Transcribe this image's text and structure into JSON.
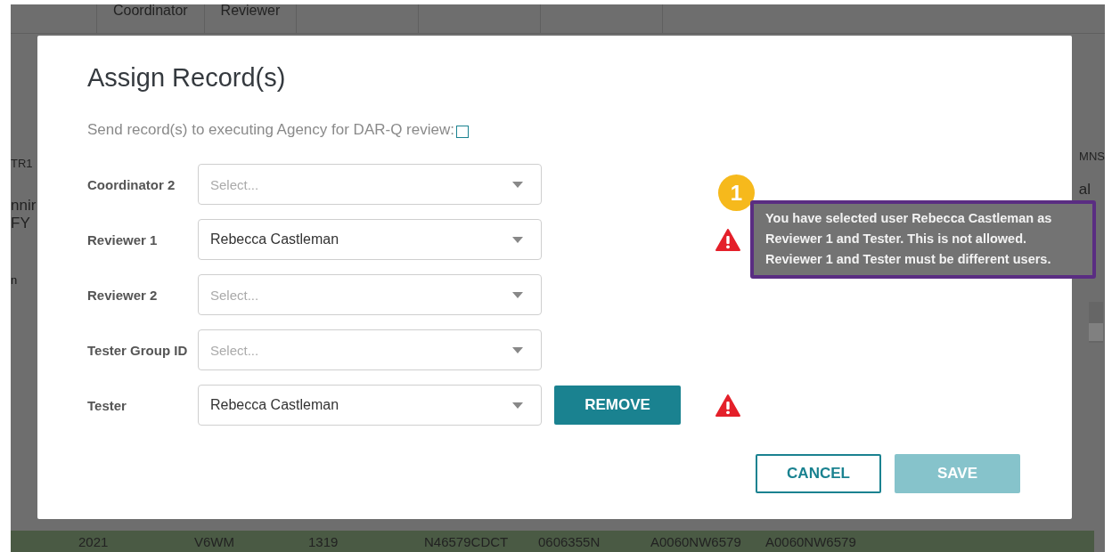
{
  "background": {
    "header_cells": [
      "Coordinator",
      "Reviewer"
    ],
    "left_fragments": [
      "TR1",
      "nnir",
      "FY",
      "n"
    ],
    "right_fragments": [
      "MNS",
      "al"
    ],
    "bottom_row": [
      "2021",
      "V6WM",
      "1319",
      "N46579CDCT",
      "0606355N",
      "A0060NW6579",
      "A0060NW6579"
    ]
  },
  "dialog": {
    "title": "Assign Record(s)",
    "send_option": {
      "label": "Send record(s) to executing Agency for DAR-Q review:",
      "checked": false
    },
    "fields": [
      {
        "label": "Coordinator 2",
        "placeholder": "Select...",
        "error": false
      },
      {
        "label": "Reviewer 1",
        "value": "Rebecca Castleman",
        "error": true
      },
      {
        "label": "Reviewer 2",
        "placeholder": "Select...",
        "error": false
      },
      {
        "label": "Tester Group ID",
        "placeholder": "Select...",
        "error": false
      },
      {
        "label": "Tester",
        "value": "Rebecca Castleman",
        "error": true,
        "action": "REMOVE"
      }
    ],
    "buttons": [
      {
        "label": "CANCEL",
        "kind": "outline",
        "disabled": false
      },
      {
        "label": "SAVE",
        "kind": "filled",
        "disabled": true
      }
    ]
  },
  "callout": {
    "badge": "1",
    "text": "You have selected user Rebecca Castleman as Reviewer 1 and Tester. This is not allowed. Reviewer 1 and Tester must be different users."
  }
}
